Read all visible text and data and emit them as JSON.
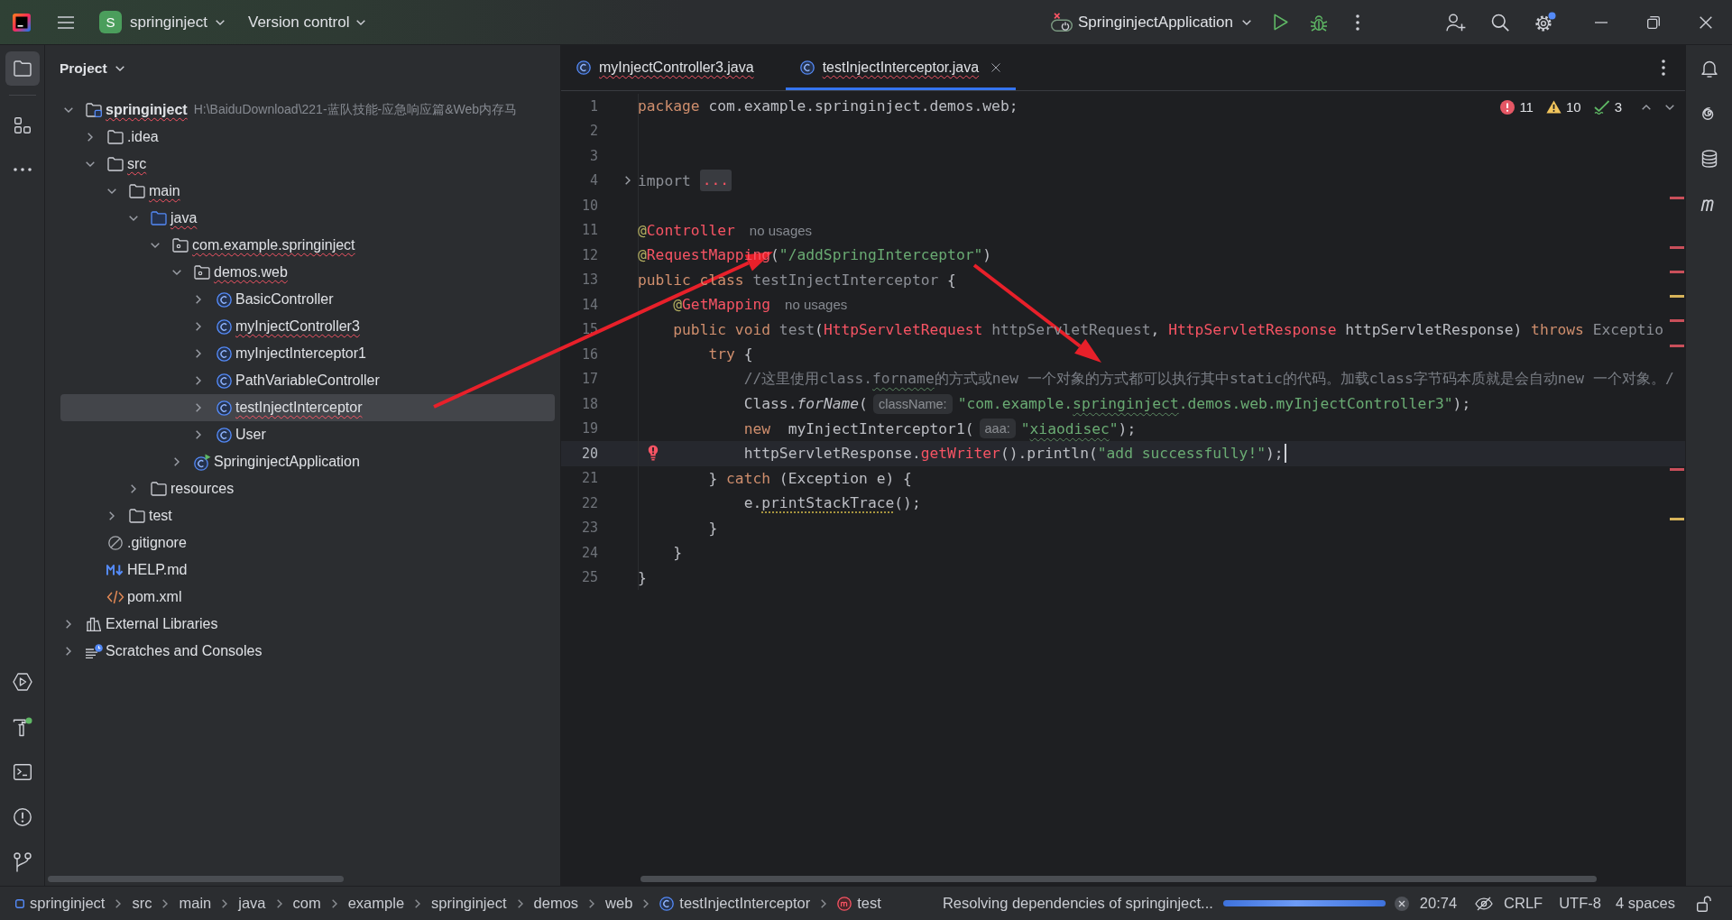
{
  "title_bar": {
    "project": {
      "badge": "S",
      "name": "springinject"
    },
    "version_control": "Version control",
    "run_configuration": "SpringinjectApplication"
  },
  "left_toolbar": {
    "top": [
      {
        "kind": "project",
        "selected": true
      },
      {
        "kind": "structure",
        "selected": false
      },
      {
        "kind": "more",
        "selected": false
      }
    ],
    "bottom": [
      {
        "kind": "run",
        "selected": false
      },
      {
        "kind": "build",
        "selected": false
      },
      {
        "kind": "terminal",
        "selected": false
      },
      {
        "kind": "problems",
        "selected": false
      },
      {
        "kind": "git",
        "selected": false
      }
    ]
  },
  "project_panel": {
    "title": "Project",
    "tree": [
      {
        "label": "springinject",
        "path": "H:\\BaiduDownload\\221-蓝队技能-应急响应篇&Web内存马",
        "kind": "module",
        "expanded": true,
        "errors": true,
        "selected": false,
        "children": [
          {
            "label": ".idea",
            "kind": "folder",
            "expanded": false,
            "errors": false,
            "selected": false
          },
          {
            "label": "src",
            "kind": "folder",
            "expanded": true,
            "errors": true,
            "selected": false,
            "children": [
              {
                "label": "main",
                "kind": "folder",
                "expanded": true,
                "errors": true,
                "selected": false,
                "children": [
                  {
                    "label": "java",
                    "kind": "source_root",
                    "expanded": true,
                    "errors": true,
                    "selected": false,
                    "children": [
                      {
                        "label": "com.example.springinject",
                        "kind": "package",
                        "expanded": true,
                        "errors": true,
                        "selected": false,
                        "children": [
                          {
                            "label": "demos.web",
                            "kind": "package",
                            "expanded": true,
                            "errors": true,
                            "selected": false,
                            "children": [
                              {
                                "label": "BasicController",
                                "kind": "class",
                                "expanded": false,
                                "errors": false,
                                "selected": false
                              },
                              {
                                "label": "myInjectController3",
                                "kind": "class",
                                "expanded": false,
                                "errors": true,
                                "selected": false
                              },
                              {
                                "label": "myInjectInterceptor1",
                                "kind": "class",
                                "expanded": false,
                                "errors": false,
                                "selected": false
                              },
                              {
                                "label": "PathVariableController",
                                "kind": "class",
                                "expanded": false,
                                "errors": false,
                                "selected": false
                              },
                              {
                                "label": "testInjectInterceptor",
                                "kind": "class",
                                "expanded": false,
                                "errors": true,
                                "selected": true
                              },
                              {
                                "label": "User",
                                "kind": "class",
                                "expanded": false,
                                "errors": false,
                                "selected": false
                              }
                            ]
                          },
                          {
                            "label": "SpringinjectApplication",
                            "kind": "app_class",
                            "expanded": false,
                            "errors": false,
                            "selected": false
                          }
                        ]
                      }
                    ]
                  },
                  {
                    "label": "resources",
                    "kind": "folder",
                    "expanded": false,
                    "errors": false,
                    "selected": false
                  }
                ]
              },
              {
                "label": "test",
                "kind": "folder",
                "expanded": false,
                "errors": false,
                "selected": false
              }
            ]
          },
          {
            "label": ".gitignore",
            "kind": "ignore_file",
            "errors": false,
            "selected": false
          },
          {
            "label": "HELP.md",
            "kind": "markdown",
            "errors": false,
            "selected": false
          },
          {
            "label": "pom.xml",
            "kind": "xml",
            "errors": false,
            "selected": false
          }
        ]
      },
      {
        "label": "External Libraries",
        "kind": "libraries",
        "expanded": false,
        "errors": false,
        "selected": false
      },
      {
        "label": "Scratches and Consoles",
        "kind": "scratches",
        "expanded": false,
        "errors": false,
        "selected": false
      }
    ]
  },
  "editor": {
    "tabs": [
      {
        "label": "myInjectController3.java",
        "errors": true,
        "selected": false
      },
      {
        "label": "testInjectInterceptor.java",
        "errors": true,
        "selected": true
      }
    ],
    "inspections": {
      "errors": "11",
      "warnings": "10",
      "typos": "3"
    },
    "lines": [
      {
        "number": "1",
        "current": false,
        "tokens": [
          {
            "kind": "kw",
            "text": "package"
          },
          {
            "kind": "plain",
            "text": " com.example.springinject.demos.web;"
          }
        ]
      },
      {
        "number": "2",
        "current": false
      },
      {
        "number": "3",
        "current": false
      },
      {
        "number": "4",
        "current": false,
        "folded": true,
        "tokens": [
          {
            "kind": "unused",
            "text": "import "
          },
          {
            "kind": "fold",
            "text": "..."
          }
        ]
      },
      {
        "number": "10",
        "current": false
      },
      {
        "number": "11",
        "current": false,
        "tokens": [
          {
            "kind": "annotation",
            "text": "@"
          },
          {
            "kind": "error",
            "text": "Controller"
          },
          {
            "kind": "usages",
            "text": "no usages"
          }
        ]
      },
      {
        "number": "12",
        "current": false,
        "tokens": [
          {
            "kind": "annotation",
            "text": "@"
          },
          {
            "kind": "error",
            "text": "RequestMapping"
          },
          {
            "kind": "plain",
            "text": "("
          },
          {
            "kind": "string",
            "text": "\"/addSpringInterceptor\""
          },
          {
            "kind": "plain",
            "text": ")"
          }
        ]
      },
      {
        "number": "13",
        "current": false,
        "tokens": [
          {
            "kind": "kw",
            "text": "public class "
          },
          {
            "kind": "unused",
            "text": "testInjectInterceptor"
          },
          {
            "kind": "plain",
            "text": " {"
          }
        ]
      },
      {
        "number": "14",
        "current": false,
        "tokens": [
          {
            "kind": "annotation",
            "text": "    @"
          },
          {
            "kind": "error",
            "text": "GetMapping"
          },
          {
            "kind": "usages",
            "text": "no usages"
          }
        ]
      },
      {
        "number": "15",
        "current": false,
        "tokens": [
          {
            "kind": "kw",
            "text": "    public void "
          },
          {
            "kind": "unused",
            "text": "test"
          },
          {
            "kind": "plain",
            "text": "("
          },
          {
            "kind": "error",
            "text": "HttpServletRequest"
          },
          {
            "kind": "unused",
            "text": " httpServletRequest"
          },
          {
            "kind": "plain",
            "text": ", "
          },
          {
            "kind": "error",
            "text": "HttpServletResponse"
          },
          {
            "kind": "plain",
            "text": " httpServletResponse) "
          },
          {
            "kind": "kw",
            "text": "throws "
          },
          {
            "kind": "unused",
            "text": "Exceptio"
          }
        ]
      },
      {
        "number": "16",
        "current": false,
        "tokens": [
          {
            "kind": "kw",
            "text": "        try"
          },
          {
            "kind": "plain",
            "text": " {"
          }
        ]
      },
      {
        "number": "17",
        "current": false,
        "tokens": [
          {
            "kind": "comment",
            "text": "            //这里使用class."
          },
          {
            "kind": "comment",
            "text": "forname",
            "typo": true
          },
          {
            "kind": "comment",
            "text": "的方式或new 一个对象的方式都可以执行其中static的代码。加载class字节码本质就是会自动new 一个对象。/"
          }
        ]
      },
      {
        "number": "18",
        "current": false,
        "tokens": [
          {
            "kind": "plain",
            "text": "            Class."
          },
          {
            "kind": "static_call",
            "text": "forName"
          },
          {
            "kind": "plain",
            "text": "("
          },
          {
            "kind": "param_hint",
            "text": "className:"
          },
          {
            "kind": "string",
            "text": "\"com.example."
          },
          {
            "kind": "string",
            "text": "springinject",
            "typo": true
          },
          {
            "kind": "string",
            "text": ".demos.web.myInjectController3\""
          },
          {
            "kind": "plain",
            "text": ");"
          }
        ]
      },
      {
        "number": "19",
        "current": false,
        "tokens": [
          {
            "kind": "kw",
            "text": "            new"
          },
          {
            "kind": "plain",
            "text": "  myInjectInterceptor1("
          },
          {
            "kind": "param_hint",
            "text": "aaa:"
          },
          {
            "kind": "string",
            "text": "\""
          },
          {
            "kind": "string",
            "text": "xiaodisec",
            "typo": true
          },
          {
            "kind": "string",
            "text": "\""
          },
          {
            "kind": "plain",
            "text": ");"
          }
        ]
      },
      {
        "number": "20",
        "current": true,
        "error_bulb": true,
        "tokens": [
          {
            "kind": "plain",
            "text": "            httpServletResponse."
          },
          {
            "kind": "error",
            "text": "getWriter"
          },
          {
            "kind": "plain",
            "text": "().println("
          },
          {
            "kind": "string",
            "text": "\"add successfully!\""
          },
          {
            "kind": "plain",
            "text": ");"
          }
        ]
      },
      {
        "number": "21",
        "current": false,
        "tokens": [
          {
            "kind": "plain",
            "text": "        } "
          },
          {
            "kind": "kw",
            "text": "catch"
          },
          {
            "kind": "plain",
            "text": " (Exception e) {"
          }
        ]
      },
      {
        "number": "22",
        "current": false,
        "tokens": [
          {
            "kind": "plain",
            "text": "            e."
          },
          {
            "kind": "plain",
            "text": "printStackTrace",
            "warning": true
          },
          {
            "kind": "plain",
            "text": "();"
          }
        ]
      },
      {
        "number": "23",
        "current": false,
        "tokens": [
          {
            "kind": "plain",
            "text": "        }"
          }
        ]
      },
      {
        "number": "24",
        "current": false,
        "tokens": [
          {
            "kind": "plain",
            "text": "    }"
          }
        ]
      },
      {
        "number": "25",
        "current": false,
        "tokens": [
          {
            "kind": "plain",
            "text": "}"
          }
        ]
      }
    ],
    "stripe_marks": [
      {
        "kind": "error"
      },
      {
        "kind": "error"
      },
      {
        "kind": "error"
      },
      {
        "kind": "warning"
      },
      {
        "kind": "error"
      },
      {
        "kind": "error"
      },
      {
        "kind": "error"
      },
      {
        "kind": "warning"
      }
    ]
  },
  "status_bar": {
    "breadcrumbs": [
      {
        "kind": "module",
        "label": "springinject"
      },
      {
        "kind": "plain",
        "label": "src"
      },
      {
        "kind": "plain",
        "label": "main"
      },
      {
        "kind": "plain",
        "label": "java"
      },
      {
        "kind": "plain",
        "label": "com"
      },
      {
        "kind": "plain",
        "label": "example"
      },
      {
        "kind": "plain",
        "label": "springinject"
      },
      {
        "kind": "plain",
        "label": "demos"
      },
      {
        "kind": "plain",
        "label": "web"
      },
      {
        "kind": "class",
        "label": "testInjectInterceptor"
      },
      {
        "kind": "method",
        "label": "test"
      }
    ],
    "task": "Resolving dependencies of springinject...",
    "progress": {
      "indeterminate": true
    },
    "caret_position": "20:74",
    "line_separator": "CRLF",
    "encoding": "UTF-8",
    "indent": "4 spaces"
  },
  "annotations": [
    {
      "kind": "arrow"
    },
    {
      "kind": "arrow"
    }
  ]
}
